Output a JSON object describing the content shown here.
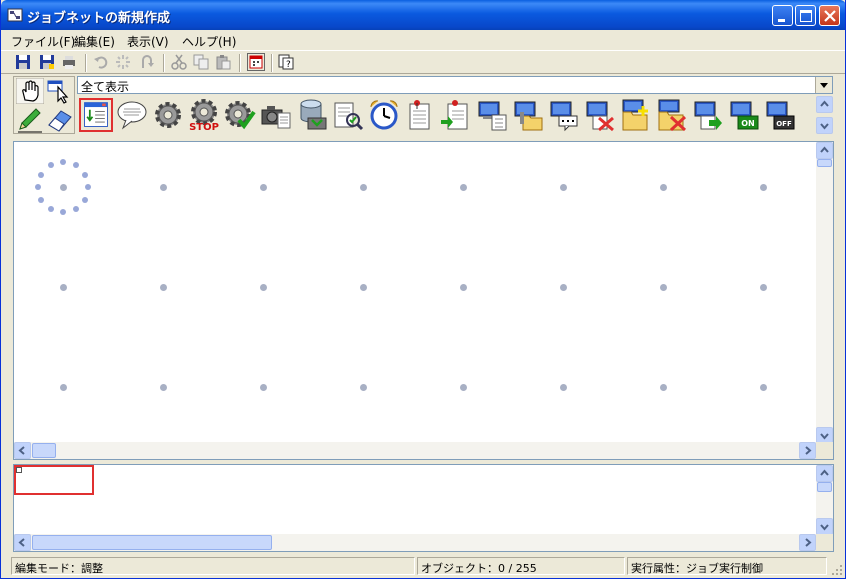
{
  "window": {
    "title": "ジョブネットの新規作成"
  },
  "menu": [
    "ファイル(F)",
    "編集(E)",
    "表示(V)",
    "ヘルプ(H)"
  ],
  "toolbar": {
    "icons": [
      "save-icon",
      "save-as-icon",
      "print-icon",
      "undo-icon",
      "redo-icon",
      "cut-icon",
      "copy-icon",
      "paste-icon",
      "calendar-icon",
      "help-icon"
    ]
  },
  "palette": {
    "filter_value": "全て表示",
    "modes": [
      "hand-icon",
      "select-icon",
      "pencil-icon",
      "eraser-icon"
    ],
    "job_icons": [
      "job-list-icon",
      "comment-icon",
      "gear-icon",
      "stop-gear-icon",
      "gear-check-icon",
      "camera-icon",
      "database-icon",
      "document-check-icon",
      "alarm-clock-icon",
      "document-pin-icon",
      "document-arrow-icon",
      "computer-list-icon",
      "computer-folder-icon",
      "computer-message-icon",
      "computer-delete-icon",
      "folder-add-icon",
      "folder-delete-icon",
      "computer-arrow-icon",
      "computer-on-icon",
      "computer-off-icon"
    ],
    "on_label": "ON",
    "off_label": "OFF",
    "stop_label": "STOP"
  },
  "status": {
    "mode": "編集モード：調整",
    "objects": "オブジェクト：0 / 255",
    "exec_attr": "実行属性：ジョブ実行制御"
  },
  "colors": {
    "title_bar": "#0a5ae0",
    "selection": "#e03030",
    "canvas": "#ffffff",
    "grid_dot": "#a8b0c4"
  }
}
